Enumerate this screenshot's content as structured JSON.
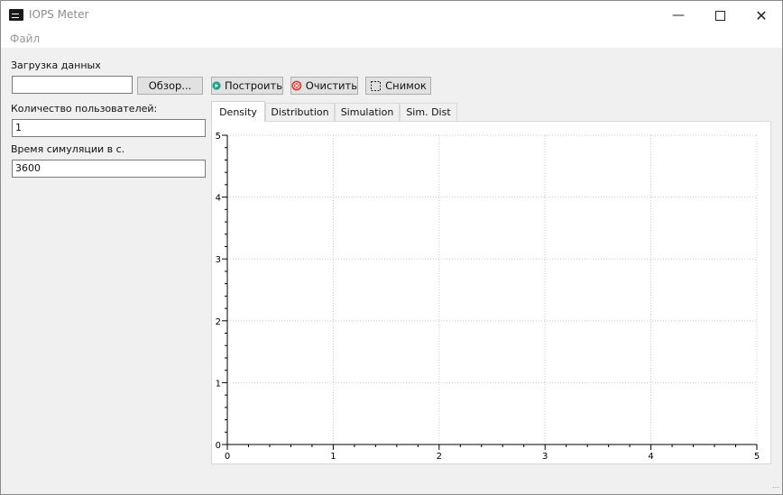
{
  "window": {
    "title": "IOPS Meter"
  },
  "menu": {
    "file": "Файл"
  },
  "load": {
    "label": "Загрузка данных",
    "path_value": "",
    "browse_label": "Обзор..."
  },
  "toolbar": {
    "build_label": "Построить",
    "clear_label": "Очистить",
    "snapshot_label": "Снимок"
  },
  "users": {
    "label": "Количество пользователей:",
    "value": "1"
  },
  "sim_time": {
    "label": "Время симуляции в с.",
    "value": "3600"
  },
  "tabs": [
    {
      "label": "Density"
    },
    {
      "label": "Distribution"
    },
    {
      "label": "Simulation"
    },
    {
      "label": "Sim. Dist"
    }
  ],
  "colors": {
    "build_icon": "#1fa38a",
    "clear_icon": "#d43f3a",
    "grid": "#c8c8c8"
  },
  "chart_data": {
    "type": "scatter",
    "series": [],
    "xlim": [
      0,
      5
    ],
    "ylim": [
      0,
      5
    ],
    "x_ticks": [
      "0",
      "1",
      "2",
      "3",
      "4",
      "5"
    ],
    "y_ticks": [
      "0",
      "1",
      "2",
      "3",
      "4",
      "5"
    ],
    "grid": true
  }
}
